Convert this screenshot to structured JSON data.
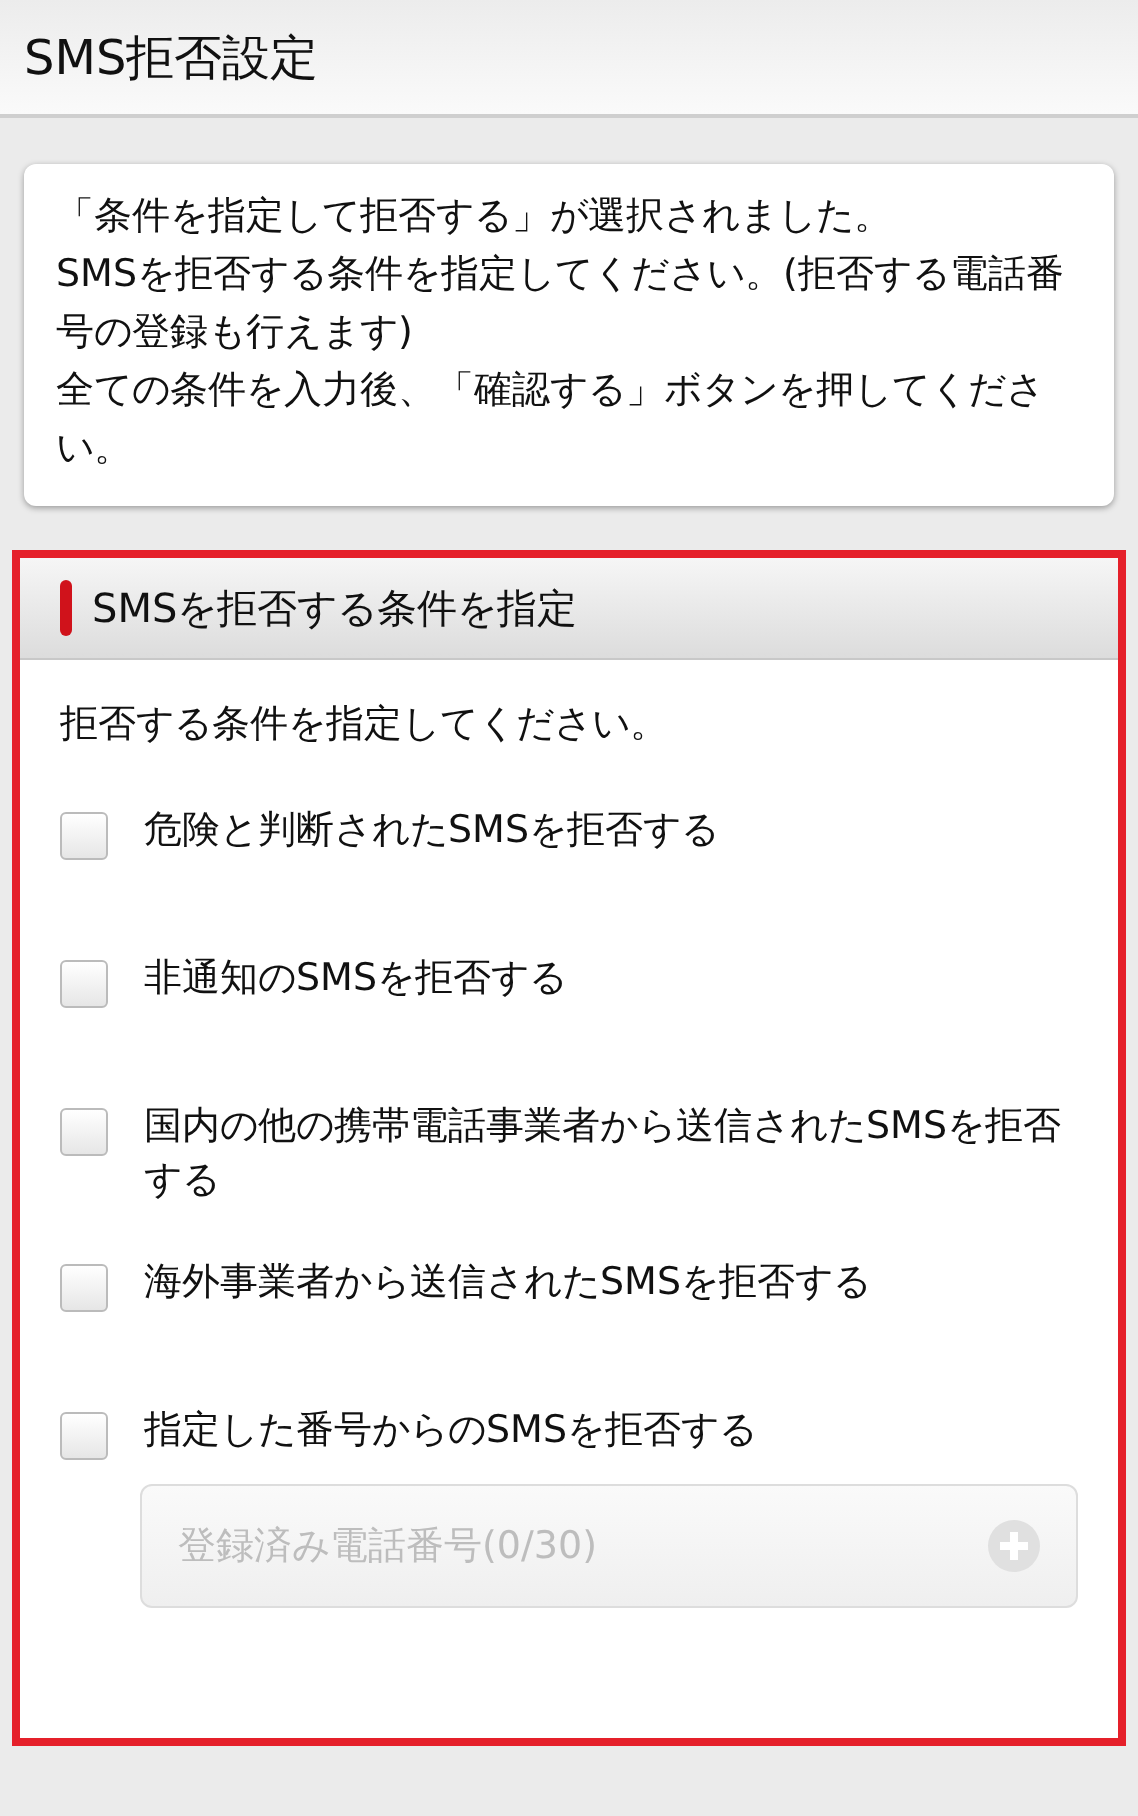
{
  "header": {
    "title": "SMS拒否設定"
  },
  "notice": {
    "lines": [
      "「条件を指定して拒否する」が選択されました。",
      "SMSを拒否する条件を指定してください。(拒否する電話番号の登録も行えます)",
      "全ての条件を入力後、「確認する」ボタンを押してください。"
    ]
  },
  "section": {
    "title": "SMSを拒否する条件を指定",
    "instruction": "拒否する条件を指定してください。",
    "options": [
      {
        "label": "危険と判断されたSMSを拒否する",
        "checked": false
      },
      {
        "label": "非通知のSMSを拒否する",
        "checked": false
      },
      {
        "label": "国内の他の携帯電話事業者から送信されたSMSを拒否する",
        "checked": false
      },
      {
        "label": "海外事業者から送信されたSMSを拒否する",
        "checked": false
      },
      {
        "label": "指定した番号からのSMSを拒否する",
        "checked": false
      }
    ],
    "registered_numbers": {
      "label": "登録済み電話番号(0/30)",
      "disabled": true
    }
  }
}
